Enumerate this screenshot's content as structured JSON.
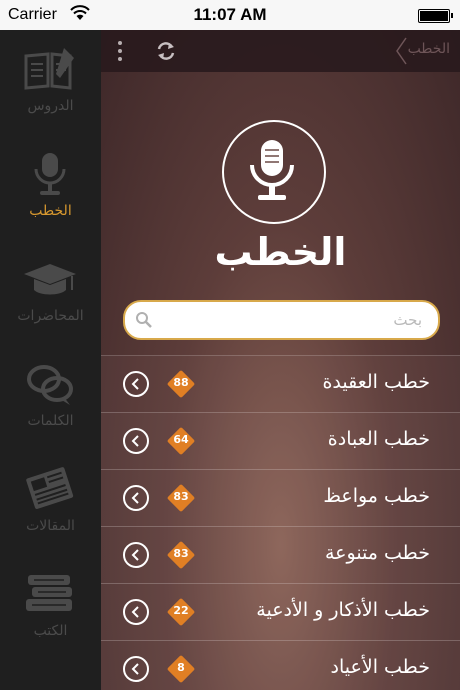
{
  "status_bar": {
    "carrier": "Carrier",
    "time": "11:07 AM"
  },
  "sidebar": {
    "items": [
      {
        "label": "الدروس",
        "icon": "book-icon",
        "active": false
      },
      {
        "label": "الخطب",
        "icon": "microphone-icon",
        "active": true
      },
      {
        "label": "المحاضرات",
        "icon": "graduation-cap-icon",
        "active": false
      },
      {
        "label": "الكلمات",
        "icon": "speech-bubbles-icon",
        "active": false
      },
      {
        "label": "المقالات",
        "icon": "newspaper-icon",
        "active": false
      },
      {
        "label": "الكتب",
        "icon": "books-stack-icon",
        "active": false
      }
    ]
  },
  "navbar": {
    "breadcrumb": "الخطب"
  },
  "hero": {
    "title": "الخطب",
    "icon": "microphone-icon"
  },
  "search": {
    "placeholder": "بحث"
  },
  "list": {
    "items": [
      {
        "title": "خطب العقيدة",
        "count": "88"
      },
      {
        "title": "خطب العبادة",
        "count": "64"
      },
      {
        "title": "خطب مواعظ",
        "count": "83"
      },
      {
        "title": "خطب متنوعة",
        "count": "83"
      },
      {
        "title": "خطب الأذكار و الأدعية",
        "count": "22"
      },
      {
        "title": "خطب الأعياد",
        "count": "8"
      }
    ]
  },
  "colors": {
    "accent": "#d7982f",
    "badge": "#e07f24",
    "sidebar_bg": "#1f1f1f"
  }
}
